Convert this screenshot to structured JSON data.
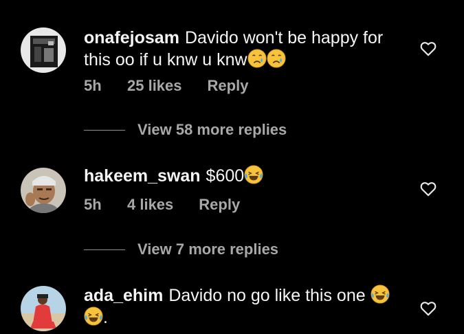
{
  "comments": [
    {
      "username": "onafejosam",
      "text": "Davido won't be happy for this oo if u knw u knw",
      "emojis": [
        "crying-face-icon",
        "crying-face-icon"
      ],
      "time": "5h",
      "likes": "25 likes",
      "reply_label": "Reply",
      "view_replies": "View 58 more replies"
    },
    {
      "username": "hakeem_swan",
      "text": "$600",
      "emojis": [
        "laughing-tears-icon"
      ],
      "time": "5h",
      "likes": "4 likes",
      "reply_label": "Reply",
      "view_replies": "View 7 more replies"
    },
    {
      "username": "ada_ehim",
      "text": "Davido no go like this one",
      "emojis": [
        "laughing-tears-icon",
        "laughing-tears-icon"
      ],
      "trailing": "."
    }
  ],
  "colors": {
    "background": "#000000",
    "text": "#f5f5f5",
    "meta": "#a8a8a8",
    "emoji_yellow": "#f7c33d"
  }
}
